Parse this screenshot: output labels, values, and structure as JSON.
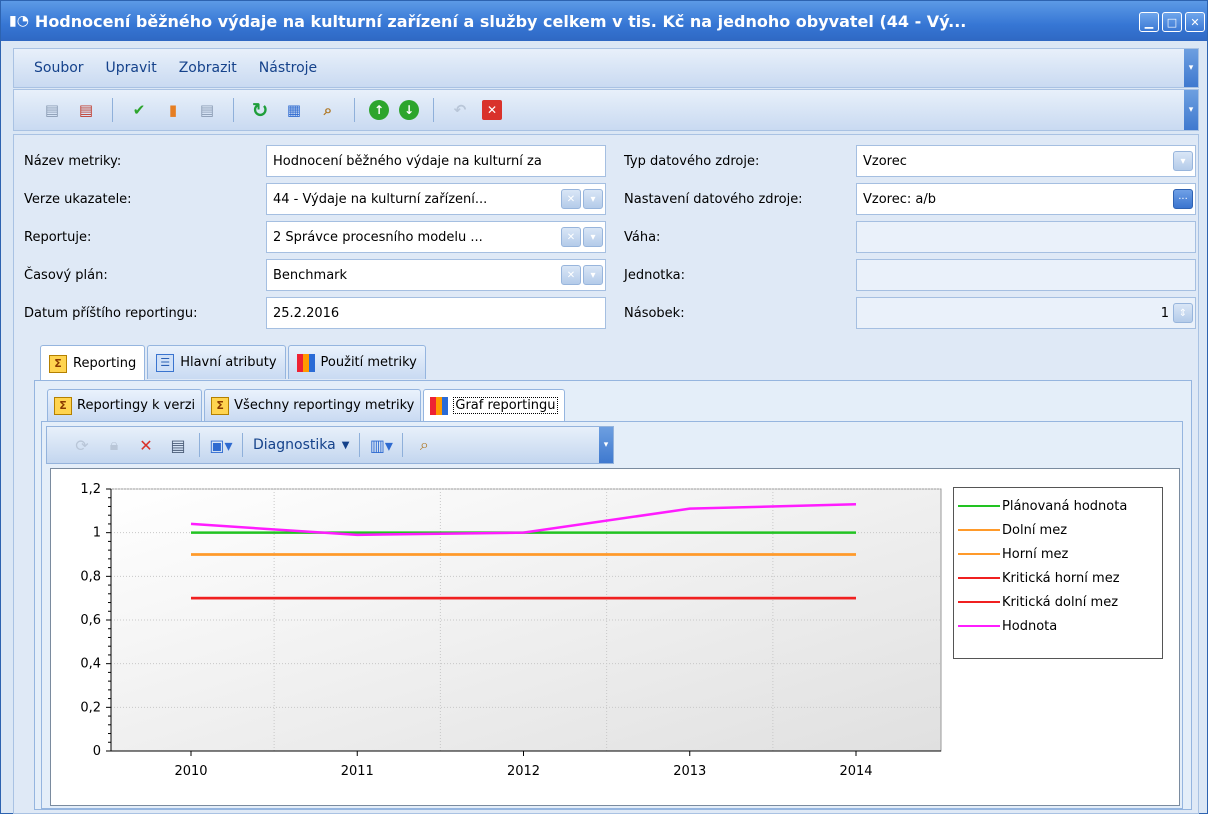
{
  "window": {
    "title": "Hodnocení běžného výdaje na kulturní zařízení a služby celkem v tis. Kč na jednoho obyvatel (44 - Vý..."
  },
  "menu": {
    "items": [
      "Soubor",
      "Upravit",
      "Zobrazit",
      "Nástroje"
    ]
  },
  "form": {
    "left": [
      {
        "label": "Název metriky:",
        "value": "Hodnocení běžného výdaje na kulturní za"
      },
      {
        "label": "Verze ukazatele:",
        "value": "44 - Výdaje na kulturní zařízení..."
      },
      {
        "label": "Reportuje:",
        "value": "2 Správce procesního modelu ..."
      },
      {
        "label": "Časový plán:",
        "value": "Benchmark"
      },
      {
        "label": "Datum příštího reportingu:",
        "value": "25.2.2016"
      }
    ],
    "right": [
      {
        "label": "Typ datového zdroje:",
        "value": "Vzorec"
      },
      {
        "label": "Nastavení datového zdroje:",
        "value": "Vzorec: a/b"
      },
      {
        "label": "Váha:",
        "value": ""
      },
      {
        "label": "Jednotka:",
        "value": ""
      },
      {
        "label": "Násobek:",
        "value": "1"
      }
    ]
  },
  "tabs": {
    "main": [
      "Reporting",
      "Hlavní atributy",
      "Použití metriky"
    ],
    "sub": [
      "Reportingy k verzi",
      "Všechny reportingy metriky",
      "Graf reportingu"
    ]
  },
  "chart_toolbar": {
    "diagnostics_label": "Diagnostika"
  },
  "chart_data": {
    "type": "line",
    "x": [
      "2010",
      "2011",
      "2012",
      "2013",
      "2014"
    ],
    "ylim": [
      0,
      1.2
    ],
    "yticks": [
      "0",
      "0,2",
      "0,4",
      "0,6",
      "0,8",
      "1",
      "1,2"
    ],
    "grid": true,
    "legend_position": "right",
    "series": [
      {
        "name": "Plánovaná hodnota",
        "color": "#22c322",
        "values": [
          1.0,
          1.0,
          1.0,
          1.0,
          1.0
        ]
      },
      {
        "name": "Dolní mez",
        "color": "#ff9a2a",
        "values": [
          0.9,
          0.9,
          0.9,
          0.9,
          0.9
        ]
      },
      {
        "name": "Horní mez",
        "color": "#ff9a2a",
        "values": [
          0.9,
          0.9,
          0.9,
          0.9,
          0.9
        ]
      },
      {
        "name": "Kritická horní mez",
        "color": "#f02020",
        "values": [
          0.7,
          0.7,
          0.7,
          0.7,
          0.7
        ]
      },
      {
        "name": "Kritická dolní mez",
        "color": "#f02020",
        "values": [
          0.7,
          0.7,
          0.7,
          0.7,
          0.7
        ]
      },
      {
        "name": "Hodnota",
        "color": "#ff1cff",
        "values": [
          1.04,
          0.99,
          1.0,
          1.11,
          1.13
        ]
      }
    ]
  }
}
